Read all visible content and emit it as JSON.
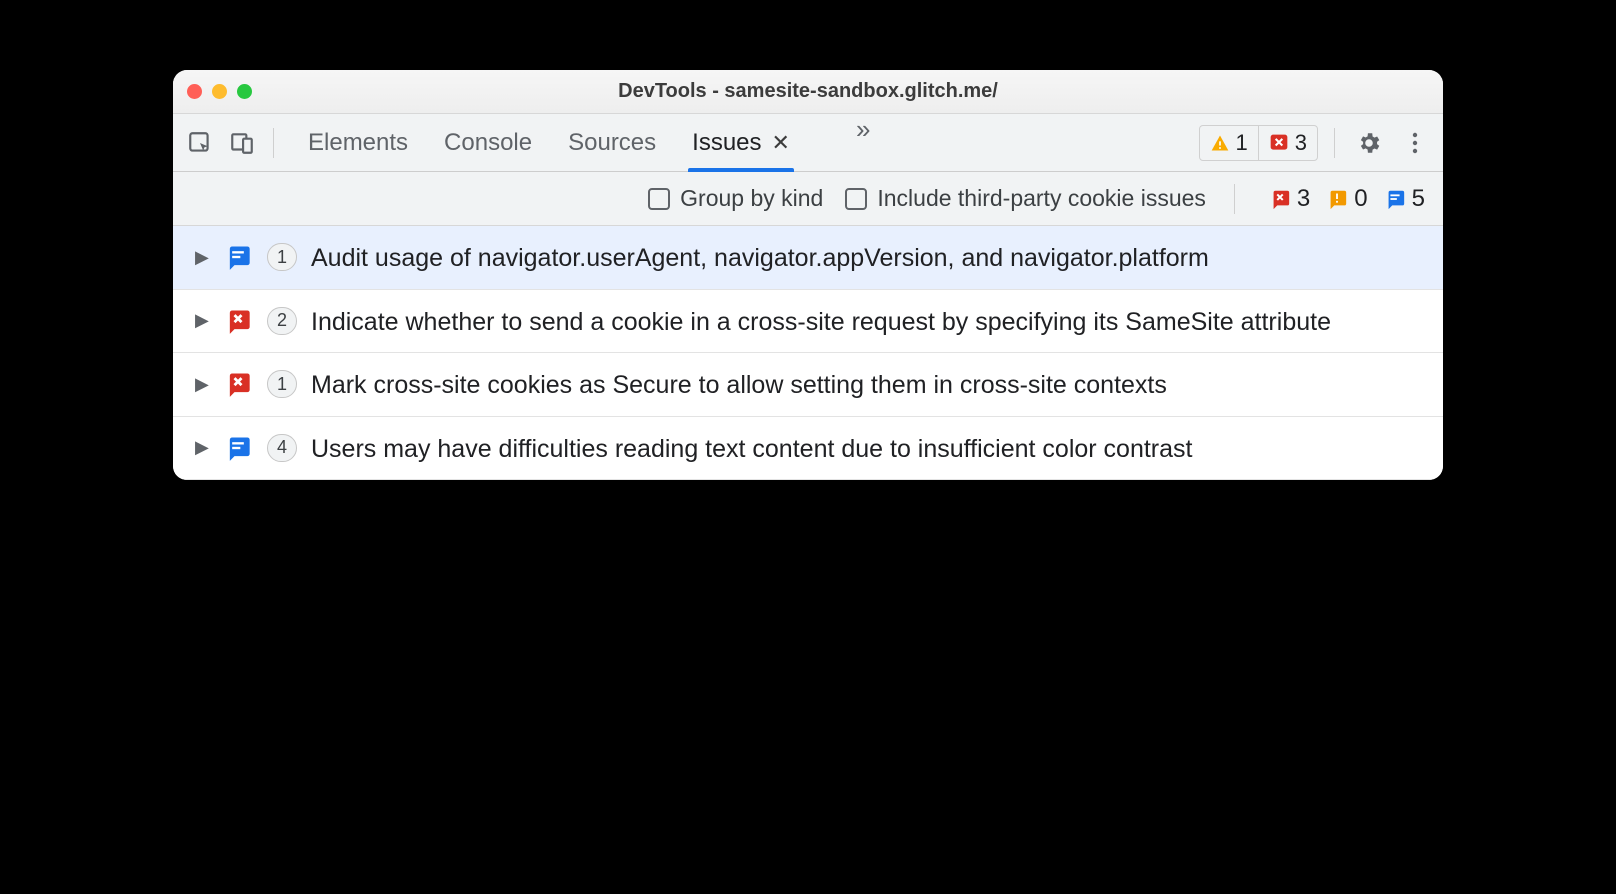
{
  "window": {
    "title": "DevTools - samesite-sandbox.glitch.me/"
  },
  "tabs": {
    "items": [
      "Elements",
      "Console",
      "Sources",
      "Issues"
    ],
    "active": "Issues"
  },
  "toolbar_badges": {
    "warning_count": "1",
    "error_count": "3"
  },
  "filters": {
    "group_by_kind": "Group by kind",
    "include_third_party": "Include third-party cookie issues",
    "counts": {
      "errors": "3",
      "warnings": "0",
      "info": "5"
    }
  },
  "issues": [
    {
      "icon": "info",
      "count": "1",
      "text": "Audit usage of navigator.userAgent, navigator.appVersion, and navigator.platform",
      "selected": true
    },
    {
      "icon": "error",
      "count": "2",
      "text": "Indicate whether to send a cookie in a cross-site request by specifying its SameSite attribute",
      "selected": false
    },
    {
      "icon": "error",
      "count": "1",
      "text": "Mark cross-site cookies as Secure to allow setting them in cross-site contexts",
      "selected": false
    },
    {
      "icon": "info",
      "count": "4",
      "text": "Users may have difficulties reading text content due to insufficient color contrast",
      "selected": false
    }
  ]
}
